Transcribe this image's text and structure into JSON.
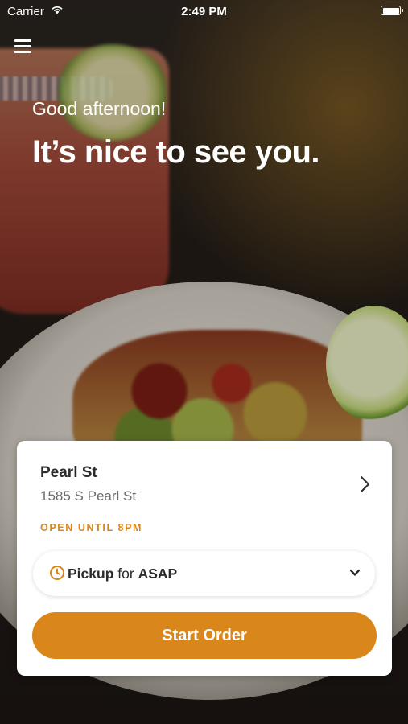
{
  "status_bar": {
    "carrier": "Carrier",
    "time": "2:49 PM",
    "icons": [
      "wifi-icon",
      "battery-icon"
    ]
  },
  "header": {
    "menu_icon": "hamburger-menu-icon"
  },
  "hero": {
    "greeting": "Good afternoon!",
    "headline": "It’s nice to see you."
  },
  "location_card": {
    "name": "Pearl St",
    "address": "1585 S Pearl St",
    "hours_status": "OPEN UNTIL 8PM",
    "hours_color": "#d9861a",
    "chevron_icon": "chevron-right-icon",
    "order_mode": {
      "icon": "clock-icon",
      "mode": "Pickup",
      "connector": "for",
      "time": "ASAP",
      "dropdown_icon": "chevron-down-icon"
    },
    "start_button_label": "Start Order",
    "accent_color": "#d9861a"
  }
}
